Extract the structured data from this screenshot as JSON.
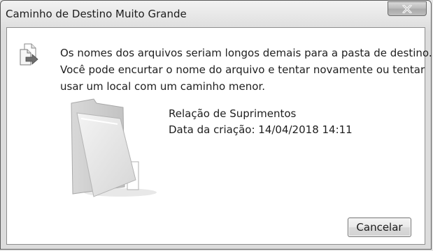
{
  "dialog": {
    "title": "Caminho de Destino Muito Grande",
    "message_lines": [
      "Os nomes dos arquivos seriam longos demais para a pasta de destino.",
      "Você pode encurtar o nome do arquivo e tentar novamente ou tentar",
      "usar um local com um caminho menor."
    ],
    "file": {
      "name": "Relação de Suprimentos",
      "created": "Data da criação: 14/04/2018 14:11"
    },
    "cancel_label": "Cancelar"
  },
  "icons": {
    "close": "close-icon",
    "message": "file-move-icon",
    "item": "folder-icon"
  }
}
